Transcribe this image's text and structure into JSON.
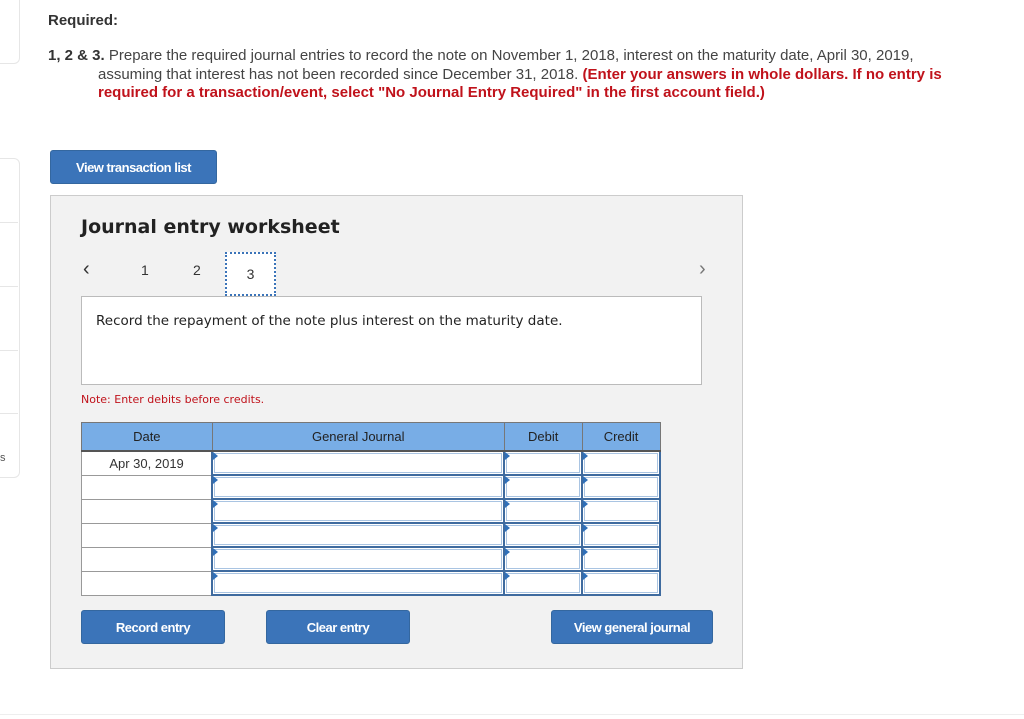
{
  "sidebar": {
    "partial_label": "s"
  },
  "question": {
    "heading": "Required:",
    "number": "1, 2 & 3.",
    "line1": " Prepare the required journal entries to record the note on November 1, 2018, interest on the maturity date, April 30, 2019,",
    "line2": "assuming that interest has not been recorded since December 31, 2018. ",
    "instruction_red_part1": "(Enter your answers in whole dollars. If no entry is",
    "instruction_red_part2": "required for a transaction/event, select \"No Journal Entry Required\" in the first account field.)"
  },
  "buttons": {
    "view_transaction_list": "View transaction list",
    "record_entry": "Record entry",
    "clear_entry": "Clear entry",
    "view_general_journal": "View general journal"
  },
  "worksheet": {
    "title": "Journal entry worksheet",
    "pager": {
      "prev_icon": "‹",
      "next_icon": "›",
      "pages": [
        "1",
        "2",
        "3"
      ],
      "current": "3"
    },
    "description": "Record the repayment of the note plus interest on the maturity date.",
    "note": "Note: Enter debits before credits."
  },
  "journal": {
    "columns": [
      "Date",
      "General Journal",
      "Debit",
      "Credit"
    ],
    "rows": [
      {
        "date": "Apr 30, 2019",
        "account": "",
        "debit": "",
        "credit": ""
      },
      {
        "date": "",
        "account": "",
        "debit": "",
        "credit": ""
      },
      {
        "date": "",
        "account": "",
        "debit": "",
        "credit": ""
      },
      {
        "date": "",
        "account": "",
        "debit": "",
        "credit": ""
      },
      {
        "date": "",
        "account": "",
        "debit": "",
        "credit": ""
      },
      {
        "date": "",
        "account": "",
        "debit": "",
        "credit": ""
      }
    ]
  },
  "colors": {
    "accent": "#3b74b9",
    "header": "#78ade6",
    "instruction": "#c0121b"
  }
}
